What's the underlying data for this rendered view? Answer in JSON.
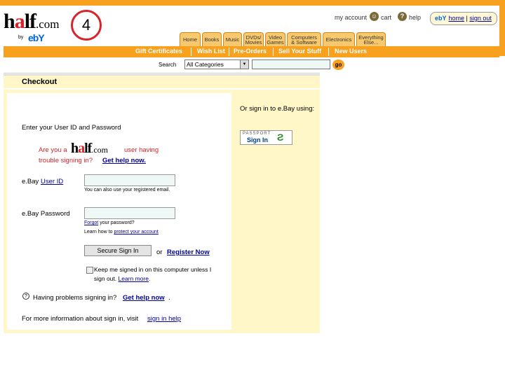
{
  "logo": {
    "half_h": "h",
    "half_a": "a",
    "half_lf": "lf",
    "half_com": ".com",
    "by": "by",
    "ebay": "ebY"
  },
  "step_badge": "4",
  "top_links": {
    "my_account": "my account",
    "cart": "cart",
    "help": "help",
    "home": "home",
    "sign_out": "sign out",
    "ebay_mark": "ebY"
  },
  "tabs": [
    {
      "label": "Home"
    },
    {
      "label": "Books"
    },
    {
      "label": "Music"
    },
    {
      "label": "DVDs/ Movies"
    },
    {
      "label": "Video Games"
    },
    {
      "label": "Computers & Software"
    },
    {
      "label": "Electronics"
    },
    {
      "label": "Everything Else..."
    }
  ],
  "nav": {
    "gift": "Gift Certificates",
    "wish": "Wish List",
    "pre": "Pre-Orders",
    "sell": "Sell Your Stuff",
    "new_users": "New Users"
  },
  "search": {
    "label": "Search",
    "selected": "All Categories",
    "go": "go"
  },
  "checkout": {
    "title": "Checkout"
  },
  "signin": {
    "enter_text": "Enter your User ID and Password",
    "trouble_pre": "Are you a",
    "trouble_mid": "user having",
    "trouble_line2": "trouble signing in?",
    "get_help_now": "Get help now.",
    "userid_label": "e.Bay",
    "userid_link": "User ID",
    "userid_hint": "You can also use your registered email.",
    "password_label": "e.Bay Password",
    "forgot_link": "Forgot",
    "forgot_rest": "your password?",
    "learn_pre": "Learn how to",
    "learn_link": "protect your account",
    "signin_button": "Secure Sign In",
    "or": "or",
    "register_link": "Register Now",
    "keep_text": "Keep me signed in on this computer unless I",
    "keep_text2": "sign out.",
    "learn_more": "Learn more",
    "problems_text": "Having problems signing in?",
    "problems_link": "Get help now",
    "more_info": "For more information about sign in, visit",
    "more_info_link": "sign in help",
    "alt_signin": "Or sign in to e.Bay using:",
    "passport_top": "PASSPORT",
    "passport_bottom": "Sign In"
  },
  "colors": {
    "orange": "#f7a11e",
    "cream": "#fff7c8",
    "red": "#d8232a",
    "link": "#00009c"
  }
}
